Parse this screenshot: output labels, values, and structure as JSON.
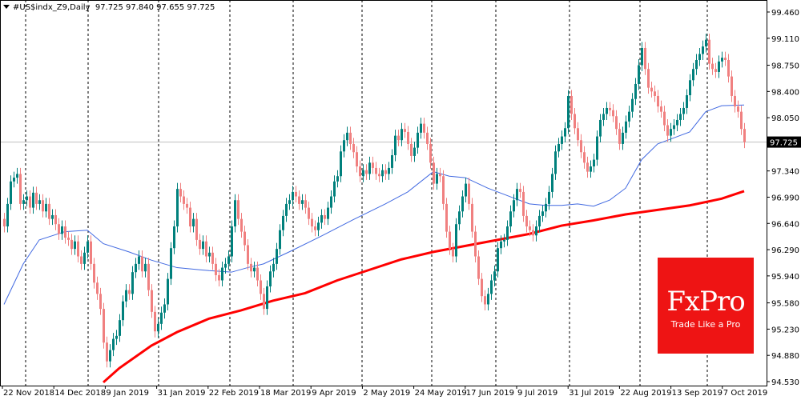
{
  "header": {
    "symbol": "#US$indx_Z9,Daily",
    "ohlc": "97.725 97.840 97.655 97.725"
  },
  "logo": {
    "brand": "FxPro",
    "tagline": "Trade Like a Pro"
  },
  "colors": {
    "bull": "#00807c",
    "bear": "#f08080",
    "ma_fast": "#4169e1",
    "ma_slow": "#ff0000",
    "current_price_line": "#c0c0c0",
    "grid": "#000000",
    "logo_bg": "#ee1414"
  },
  "chart_data": {
    "type": "candlestick",
    "title": "",
    "ylim": [
      94.53,
      99.46
    ],
    "y_ticks": [
      "99.460",
      "99.110",
      "98.750",
      "98.400",
      "98.050",
      "97.340",
      "96.990",
      "96.640",
      "96.290",
      "95.940",
      "95.580",
      "95.230",
      "94.880",
      "94.530"
    ],
    "current_price": "97.725",
    "x_tick_labels": [
      "22 Nov 2018",
      "14 Dec 2018",
      "9 Jan 2019",
      "31 Jan 2019",
      "22 Feb 2019",
      "18 Mar 2019",
      "9 Apr 2019",
      "2 May 2019",
      "24 May 2019",
      "17 Jun 2019",
      "9 Jul 2019",
      "31 Jul 2019",
      "22 Aug 2019",
      "13 Sep 2019",
      "7 Oct 2019"
    ],
    "grid": "vertical dashed at month starts",
    "closes": [
      96.6,
      96.9,
      97.2,
      97.25,
      97.3,
      96.9,
      96.95,
      97.0,
      96.85,
      97.05,
      96.9,
      96.95,
      96.8,
      96.9,
      96.7,
      96.75,
      96.63,
      96.5,
      96.6,
      96.45,
      96.42,
      96.3,
      96.4,
      96.2,
      96.1,
      96.25,
      96.4,
      96.1,
      95.85,
      95.7,
      95.5,
      95.05,
      94.8,
      94.95,
      95.1,
      95.14,
      95.35,
      95.6,
      95.75,
      95.7,
      95.99,
      96.1,
      96.2,
      96.0,
      96.1,
      95.75,
      95.46,
      95.2,
      95.3,
      95.45,
      95.56,
      95.9,
      96.31,
      96.6,
      97.1,
      97.0,
      96.9,
      96.85,
      96.6,
      96.7,
      96.42,
      96.3,
      96.4,
      96.2,
      96.25,
      96.1,
      95.95,
      95.88,
      96.05,
      96.1,
      96.2,
      96.6,
      96.95,
      96.7,
      96.53,
      96.35,
      96.1,
      96.0,
      96.05,
      95.88,
      95.7,
      95.5,
      95.8,
      96.0,
      96.1,
      96.3,
      96.55,
      96.74,
      96.9,
      96.95,
      97.06,
      97.0,
      96.9,
      96.95,
      96.85,
      96.7,
      96.6,
      96.55,
      96.65,
      96.75,
      96.7,
      96.85,
      97.0,
      97.2,
      97.27,
      97.6,
      97.75,
      97.85,
      97.7,
      97.59,
      97.4,
      97.27,
      97.35,
      97.3,
      97.45,
      97.38,
      97.3,
      97.27,
      97.35,
      97.3,
      97.38,
      97.55,
      97.81,
      97.75,
      97.9,
      97.86,
      97.7,
      97.54,
      97.65,
      97.85,
      97.97,
      97.85,
      97.7,
      97.45,
      97.17,
      97.3,
      97.27,
      96.9,
      96.53,
      96.3,
      96.2,
      96.63,
      96.8,
      97.0,
      97.17,
      96.9,
      96.53,
      96.2,
      95.9,
      95.67,
      95.56,
      95.7,
      95.88,
      96.0,
      96.31,
      96.4,
      96.42,
      96.6,
      96.8,
      96.95,
      97.1,
      97.06,
      96.74,
      96.6,
      96.55,
      96.48,
      96.6,
      96.74,
      96.8,
      96.9,
      97.06,
      97.3,
      97.6,
      97.7,
      97.8,
      97.91,
      98.34,
      98.1,
      97.91,
      97.75,
      97.59,
      97.45,
      97.33,
      97.4,
      97.49,
      97.8,
      98.02,
      98.1,
      98.18,
      98.15,
      98.07,
      97.9,
      97.7,
      97.85,
      98.0,
      98.13,
      98.3,
      98.5,
      98.75,
      98.98,
      98.7,
      98.45,
      98.4,
      98.34,
      98.2,
      98.13,
      97.95,
      97.81,
      97.9,
      97.95,
      98.02,
      98.1,
      98.18,
      98.35,
      98.55,
      98.7,
      98.82,
      98.9,
      99.0,
      99.09,
      98.77,
      98.7,
      98.66,
      98.8,
      98.85,
      98.82,
      98.6,
      98.34,
      98.2,
      98.13,
      97.9,
      97.725
    ],
    "ma_fast": [
      [
        0,
        95.56
      ],
      [
        6,
        96.1
      ],
      [
        11,
        96.42
      ],
      [
        19,
        96.53
      ],
      [
        26,
        96.55
      ],
      [
        31,
        96.37
      ],
      [
        39,
        96.26
      ],
      [
        46,
        96.15
      ],
      [
        54,
        96.05
      ],
      [
        64,
        96.01
      ],
      [
        71,
        95.99
      ],
      [
        76,
        96.05
      ],
      [
        81,
        96.1
      ],
      [
        89,
        96.26
      ],
      [
        99,
        96.47
      ],
      [
        109,
        96.69
      ],
      [
        119,
        96.9
      ],
      [
        126,
        97.06
      ],
      [
        134,
        97.33
      ],
      [
        139,
        97.27
      ],
      [
        144,
        97.25
      ],
      [
        151,
        97.11
      ],
      [
        159,
        96.98
      ],
      [
        164,
        96.9
      ],
      [
        169,
        96.88
      ],
      [
        174,
        96.88
      ],
      [
        179,
        96.9
      ],
      [
        184,
        96.87
      ],
      [
        189,
        96.95
      ],
      [
        194,
        97.11
      ],
      [
        199,
        97.49
      ],
      [
        204,
        97.7
      ],
      [
        209,
        97.78
      ],
      [
        214,
        97.86
      ],
      [
        219,
        98.13
      ],
      [
        224,
        98.21
      ],
      [
        231,
        98.22
      ]
    ],
    "ma_slow": [
      [
        31,
        94.52
      ],
      [
        36,
        94.71
      ],
      [
        46,
        95.01
      ],
      [
        54,
        95.19
      ],
      [
        64,
        95.37
      ],
      [
        74,
        95.48
      ],
      [
        84,
        95.61
      ],
      [
        94,
        95.71
      ],
      [
        104,
        95.88
      ],
      [
        114,
        96.02
      ],
      [
        124,
        96.16
      ],
      [
        134,
        96.26
      ],
      [
        144,
        96.34
      ],
      [
        154,
        96.42
      ],
      [
        164,
        96.5
      ],
      [
        174,
        96.61
      ],
      [
        184,
        96.68
      ],
      [
        194,
        96.76
      ],
      [
        204,
        96.82
      ],
      [
        214,
        96.88
      ],
      [
        224,
        96.97
      ],
      [
        231,
        97.07
      ]
    ]
  }
}
